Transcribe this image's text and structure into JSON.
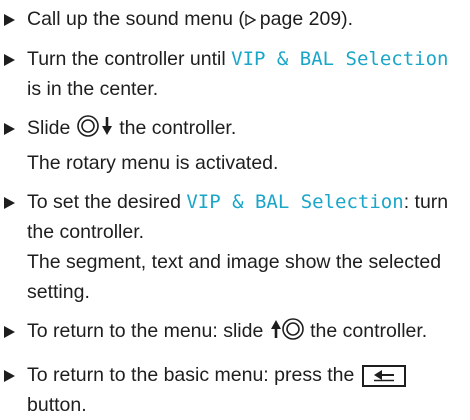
{
  "steps": [
    {
      "text_a": "Call up the sound menu (",
      "ref_page": "page 209",
      "text_b": ")."
    },
    {
      "text_a": "Turn the controller until ",
      "ui": "VIP & BAL Selection",
      "text_b": " is in the center."
    },
    {
      "text_a": "Slide ",
      "text_b": " the controller.",
      "result": "The rotary menu is activated."
    },
    {
      "text_a": "To set the desired ",
      "ui": "VIP & BAL Selection",
      "text_b": ": turn the controller.",
      "result": "The segment, text and image show the selected setting."
    },
    {
      "text_a": "To return to the menu: slide ",
      "text_b": " the controller."
    },
    {
      "text_a": "To return to the basic menu: press the ",
      "text_b": " button."
    }
  ],
  "icons": {
    "bullet": "triangle-right-icon",
    "page_ref": "triangle-outline-right-icon",
    "controller_down": "controller-slide-down-icon",
    "controller_up": "controller-slide-up-icon",
    "back_button": "back-arrow-icon"
  },
  "colors": {
    "text": "#1e1e1e",
    "ui_label": "#1aa6c8"
  }
}
